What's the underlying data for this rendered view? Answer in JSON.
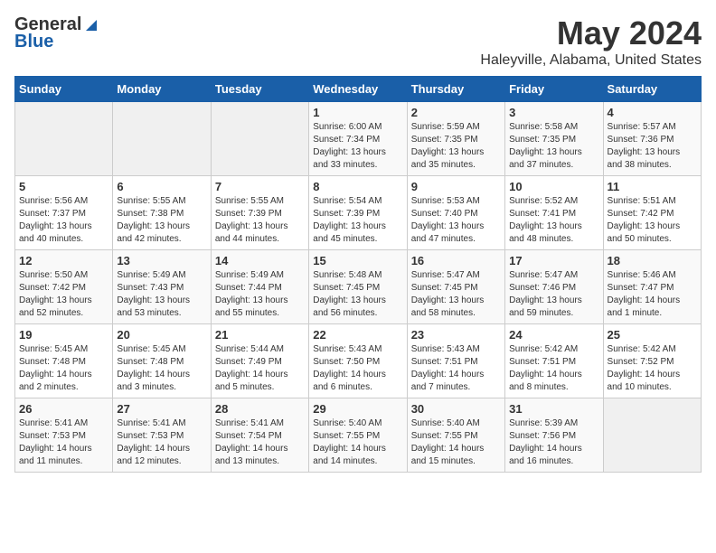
{
  "header": {
    "logo_general": "General",
    "logo_blue": "Blue",
    "title": "May 2024",
    "location": "Haleyville, Alabama, United States"
  },
  "calendar": {
    "days_of_week": [
      "Sunday",
      "Monday",
      "Tuesday",
      "Wednesday",
      "Thursday",
      "Friday",
      "Saturday"
    ],
    "weeks": [
      [
        {
          "day": "",
          "info": ""
        },
        {
          "day": "",
          "info": ""
        },
        {
          "day": "",
          "info": ""
        },
        {
          "day": "1",
          "info": "Sunrise: 6:00 AM\nSunset: 7:34 PM\nDaylight: 13 hours\nand 33 minutes."
        },
        {
          "day": "2",
          "info": "Sunrise: 5:59 AM\nSunset: 7:35 PM\nDaylight: 13 hours\nand 35 minutes."
        },
        {
          "day": "3",
          "info": "Sunrise: 5:58 AM\nSunset: 7:35 PM\nDaylight: 13 hours\nand 37 minutes."
        },
        {
          "day": "4",
          "info": "Sunrise: 5:57 AM\nSunset: 7:36 PM\nDaylight: 13 hours\nand 38 minutes."
        }
      ],
      [
        {
          "day": "5",
          "info": "Sunrise: 5:56 AM\nSunset: 7:37 PM\nDaylight: 13 hours\nand 40 minutes."
        },
        {
          "day": "6",
          "info": "Sunrise: 5:55 AM\nSunset: 7:38 PM\nDaylight: 13 hours\nand 42 minutes."
        },
        {
          "day": "7",
          "info": "Sunrise: 5:55 AM\nSunset: 7:39 PM\nDaylight: 13 hours\nand 44 minutes."
        },
        {
          "day": "8",
          "info": "Sunrise: 5:54 AM\nSunset: 7:39 PM\nDaylight: 13 hours\nand 45 minutes."
        },
        {
          "day": "9",
          "info": "Sunrise: 5:53 AM\nSunset: 7:40 PM\nDaylight: 13 hours\nand 47 minutes."
        },
        {
          "day": "10",
          "info": "Sunrise: 5:52 AM\nSunset: 7:41 PM\nDaylight: 13 hours\nand 48 minutes."
        },
        {
          "day": "11",
          "info": "Sunrise: 5:51 AM\nSunset: 7:42 PM\nDaylight: 13 hours\nand 50 minutes."
        }
      ],
      [
        {
          "day": "12",
          "info": "Sunrise: 5:50 AM\nSunset: 7:42 PM\nDaylight: 13 hours\nand 52 minutes."
        },
        {
          "day": "13",
          "info": "Sunrise: 5:49 AM\nSunset: 7:43 PM\nDaylight: 13 hours\nand 53 minutes."
        },
        {
          "day": "14",
          "info": "Sunrise: 5:49 AM\nSunset: 7:44 PM\nDaylight: 13 hours\nand 55 minutes."
        },
        {
          "day": "15",
          "info": "Sunrise: 5:48 AM\nSunset: 7:45 PM\nDaylight: 13 hours\nand 56 minutes."
        },
        {
          "day": "16",
          "info": "Sunrise: 5:47 AM\nSunset: 7:45 PM\nDaylight: 13 hours\nand 58 minutes."
        },
        {
          "day": "17",
          "info": "Sunrise: 5:47 AM\nSunset: 7:46 PM\nDaylight: 13 hours\nand 59 minutes."
        },
        {
          "day": "18",
          "info": "Sunrise: 5:46 AM\nSunset: 7:47 PM\nDaylight: 14 hours\nand 1 minute."
        }
      ],
      [
        {
          "day": "19",
          "info": "Sunrise: 5:45 AM\nSunset: 7:48 PM\nDaylight: 14 hours\nand 2 minutes."
        },
        {
          "day": "20",
          "info": "Sunrise: 5:45 AM\nSunset: 7:48 PM\nDaylight: 14 hours\nand 3 minutes."
        },
        {
          "day": "21",
          "info": "Sunrise: 5:44 AM\nSunset: 7:49 PM\nDaylight: 14 hours\nand 5 minutes."
        },
        {
          "day": "22",
          "info": "Sunrise: 5:43 AM\nSunset: 7:50 PM\nDaylight: 14 hours\nand 6 minutes."
        },
        {
          "day": "23",
          "info": "Sunrise: 5:43 AM\nSunset: 7:51 PM\nDaylight: 14 hours\nand 7 minutes."
        },
        {
          "day": "24",
          "info": "Sunrise: 5:42 AM\nSunset: 7:51 PM\nDaylight: 14 hours\nand 8 minutes."
        },
        {
          "day": "25",
          "info": "Sunrise: 5:42 AM\nSunset: 7:52 PM\nDaylight: 14 hours\nand 10 minutes."
        }
      ],
      [
        {
          "day": "26",
          "info": "Sunrise: 5:41 AM\nSunset: 7:53 PM\nDaylight: 14 hours\nand 11 minutes."
        },
        {
          "day": "27",
          "info": "Sunrise: 5:41 AM\nSunset: 7:53 PM\nDaylight: 14 hours\nand 12 minutes."
        },
        {
          "day": "28",
          "info": "Sunrise: 5:41 AM\nSunset: 7:54 PM\nDaylight: 14 hours\nand 13 minutes."
        },
        {
          "day": "29",
          "info": "Sunrise: 5:40 AM\nSunset: 7:55 PM\nDaylight: 14 hours\nand 14 minutes."
        },
        {
          "day": "30",
          "info": "Sunrise: 5:40 AM\nSunset: 7:55 PM\nDaylight: 14 hours\nand 15 minutes."
        },
        {
          "day": "31",
          "info": "Sunrise: 5:39 AM\nSunset: 7:56 PM\nDaylight: 14 hours\nand 16 minutes."
        },
        {
          "day": "",
          "info": ""
        }
      ]
    ]
  }
}
